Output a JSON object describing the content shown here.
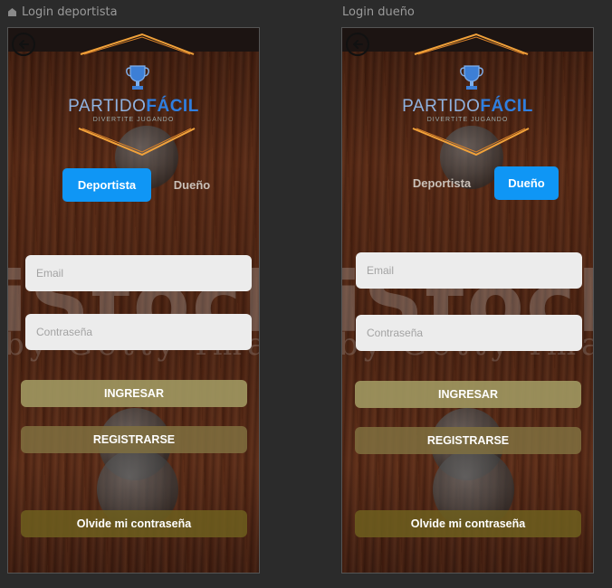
{
  "screens": [
    {
      "frame_label": "Login deportista",
      "brand_part1": "PARTIDO",
      "brand_part2": "FÁCIL",
      "tagline": "DIVERTITE JUGANDO",
      "toggle_deportista": "Deportista",
      "toggle_dueno": "Dueño",
      "active_toggle": "deportista",
      "email_placeholder": "Email",
      "password_placeholder": "Contraseña",
      "ingresar_label": "INGRESAR",
      "registrarse_label": "REGISTRARSE",
      "olvide_label": "Olvide mi contraseña"
    },
    {
      "frame_label": "Login dueño",
      "brand_part1": "PARTIDO",
      "brand_part2": "FÁCIL",
      "tagline": "DIVERTITE JUGANDO",
      "toggle_deportista": "Deportista",
      "toggle_dueno": "Dueño",
      "active_toggle": "dueno",
      "email_placeholder": "Email",
      "password_placeholder": "Contraseña",
      "ingresar_label": "INGRESAR",
      "registrarse_label": "REGISTRARSE",
      "olvide_label": "Olvide mi contraseña"
    }
  ],
  "watermark": {
    "main": "iStock",
    "sub": "by Getty Images"
  },
  "colors": {
    "accent_blue": "#0f96f5",
    "brand_orange": "#f2a23a",
    "brand_blue": "#2f7fe0"
  },
  "icons": {
    "back": "arrow-left-circle-icon",
    "trophy": "trophy-icon",
    "frame": "home-icon"
  }
}
